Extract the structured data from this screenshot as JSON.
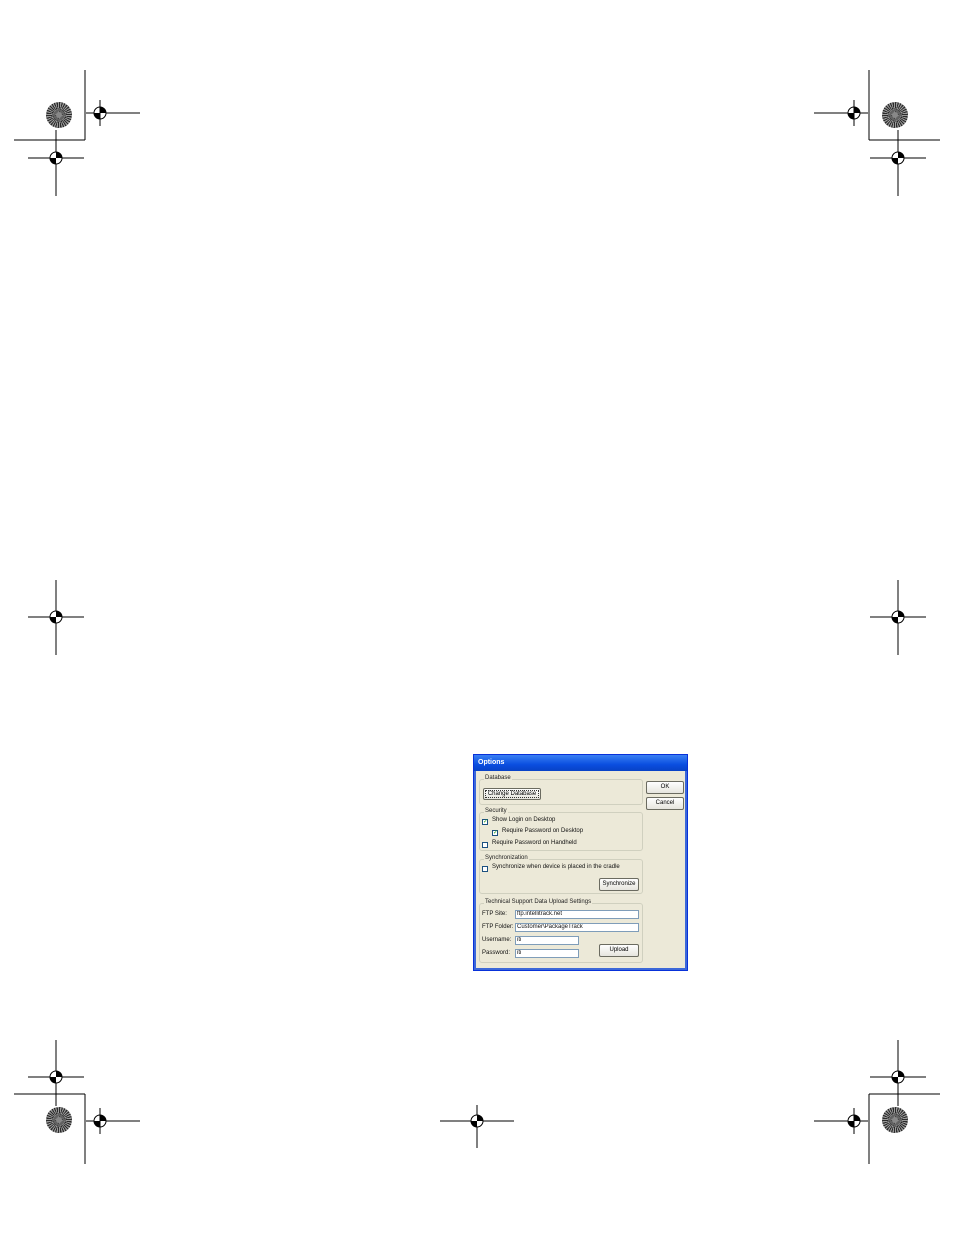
{
  "dialog": {
    "title": "Options",
    "ok_label": "OK",
    "cancel_label": "Cancel",
    "database": {
      "group_label": "Database",
      "change_button": "Change Database"
    },
    "security": {
      "group_label": "Security",
      "show_login": {
        "label": "Show Login on Desktop",
        "checked": true
      },
      "require_password_desktop": {
        "label": "Require Password on Desktop",
        "checked": true
      },
      "require_password_handheld": {
        "label": "Require Password on Handheld",
        "checked": false
      }
    },
    "synchronization": {
      "group_label": "Synchronization",
      "sync_on_cradle": {
        "label": "Synchronize when device is placed in the cradle",
        "checked": false
      },
      "sync_button": "Synchronize"
    },
    "tech_support": {
      "group_label": "Technical Support Data Upload Settings",
      "ftp_site_label": "FTP Site:",
      "ftp_site_value": "ftp.intellitrack.net",
      "ftp_folder_label": "FTP Folder:",
      "ftp_folder_value": "Customer\\PackageTrack",
      "username_label": "Username:",
      "username_value": "iti",
      "password_label": "Password:",
      "password_value": "iti",
      "upload_button": "Upload"
    }
  }
}
